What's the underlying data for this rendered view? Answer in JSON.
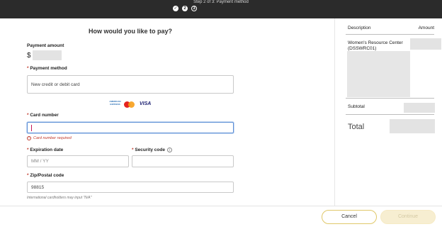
{
  "header": {
    "step_text": "Step 2 of 3: Payment method",
    "steps": [
      "✓",
      "2",
      "3"
    ]
  },
  "form": {
    "title": "How would you like to pay?",
    "payment_amount_label": "Payment amount",
    "currency_symbol": "$",
    "payment_method_label": "Payment method",
    "payment_method_value": "New credit or debit card",
    "accepted_cards": [
      "AMERICAN EXPRESS",
      "mastercard",
      "VISA"
    ],
    "card_number_label": "Card number",
    "card_number_value": "",
    "card_number_error": "Card number required",
    "expiration_label": "Expiration date",
    "expiration_placeholder": "MM / YY",
    "security_code_label": "Security code",
    "zip_label": "Zip/Postal code",
    "zip_value": "98815",
    "hint": "International cardholders may input \"N/A\"",
    "required_mark": "*"
  },
  "summary": {
    "col_description": "Description",
    "col_amount": "Amount",
    "item_name": "Women's Resource Center (DSSWRC01)",
    "subtotal_label": "Subtotal",
    "total_label": "Total"
  },
  "footer": {
    "cancel_label": "Cancel",
    "continue_label": "Continue"
  },
  "colors": {
    "header_bg": "#2b2b2b",
    "required": "#c0392b",
    "focus": "#5b8ed6",
    "button_outline": "#e0c86a",
    "continue_disabled": "#f7eed1"
  }
}
